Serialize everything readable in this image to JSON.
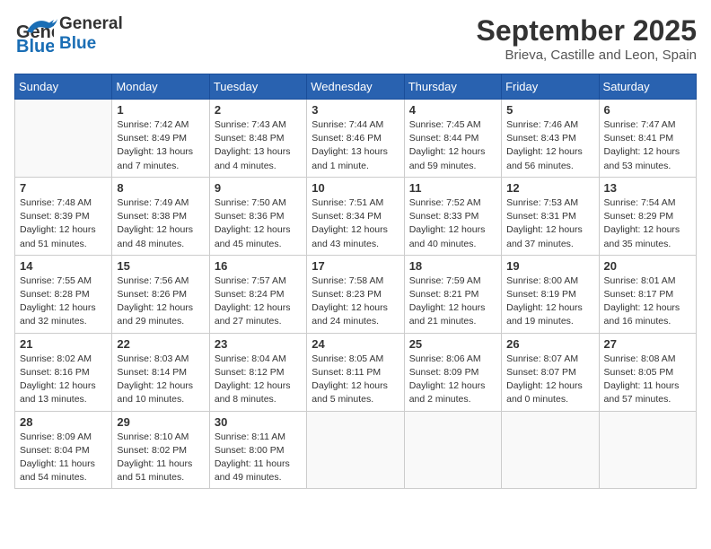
{
  "header": {
    "logo_general": "General",
    "logo_blue": "Blue",
    "month": "September 2025",
    "location": "Brieva, Castille and Leon, Spain"
  },
  "weekdays": [
    "Sunday",
    "Monday",
    "Tuesday",
    "Wednesday",
    "Thursday",
    "Friday",
    "Saturday"
  ],
  "weeks": [
    [
      {
        "day": "",
        "sunrise": "",
        "sunset": "",
        "daylight": "",
        "empty": true
      },
      {
        "day": "1",
        "sunrise": "Sunrise: 7:42 AM",
        "sunset": "Sunset: 8:49 PM",
        "daylight": "Daylight: 13 hours and 7 minutes."
      },
      {
        "day": "2",
        "sunrise": "Sunrise: 7:43 AM",
        "sunset": "Sunset: 8:48 PM",
        "daylight": "Daylight: 13 hours and 4 minutes."
      },
      {
        "day": "3",
        "sunrise": "Sunrise: 7:44 AM",
        "sunset": "Sunset: 8:46 PM",
        "daylight": "Daylight: 13 hours and 1 minute."
      },
      {
        "day": "4",
        "sunrise": "Sunrise: 7:45 AM",
        "sunset": "Sunset: 8:44 PM",
        "daylight": "Daylight: 12 hours and 59 minutes."
      },
      {
        "day": "5",
        "sunrise": "Sunrise: 7:46 AM",
        "sunset": "Sunset: 8:43 PM",
        "daylight": "Daylight: 12 hours and 56 minutes."
      },
      {
        "day": "6",
        "sunrise": "Sunrise: 7:47 AM",
        "sunset": "Sunset: 8:41 PM",
        "daylight": "Daylight: 12 hours and 53 minutes."
      }
    ],
    [
      {
        "day": "7",
        "sunrise": "Sunrise: 7:48 AM",
        "sunset": "Sunset: 8:39 PM",
        "daylight": "Daylight: 12 hours and 51 minutes."
      },
      {
        "day": "8",
        "sunrise": "Sunrise: 7:49 AM",
        "sunset": "Sunset: 8:38 PM",
        "daylight": "Daylight: 12 hours and 48 minutes."
      },
      {
        "day": "9",
        "sunrise": "Sunrise: 7:50 AM",
        "sunset": "Sunset: 8:36 PM",
        "daylight": "Daylight: 12 hours and 45 minutes."
      },
      {
        "day": "10",
        "sunrise": "Sunrise: 7:51 AM",
        "sunset": "Sunset: 8:34 PM",
        "daylight": "Daylight: 12 hours and 43 minutes."
      },
      {
        "day": "11",
        "sunrise": "Sunrise: 7:52 AM",
        "sunset": "Sunset: 8:33 PM",
        "daylight": "Daylight: 12 hours and 40 minutes."
      },
      {
        "day": "12",
        "sunrise": "Sunrise: 7:53 AM",
        "sunset": "Sunset: 8:31 PM",
        "daylight": "Daylight: 12 hours and 37 minutes."
      },
      {
        "day": "13",
        "sunrise": "Sunrise: 7:54 AM",
        "sunset": "Sunset: 8:29 PM",
        "daylight": "Daylight: 12 hours and 35 minutes."
      }
    ],
    [
      {
        "day": "14",
        "sunrise": "Sunrise: 7:55 AM",
        "sunset": "Sunset: 8:28 PM",
        "daylight": "Daylight: 12 hours and 32 minutes."
      },
      {
        "day": "15",
        "sunrise": "Sunrise: 7:56 AM",
        "sunset": "Sunset: 8:26 PM",
        "daylight": "Daylight: 12 hours and 29 minutes."
      },
      {
        "day": "16",
        "sunrise": "Sunrise: 7:57 AM",
        "sunset": "Sunset: 8:24 PM",
        "daylight": "Daylight: 12 hours and 27 minutes."
      },
      {
        "day": "17",
        "sunrise": "Sunrise: 7:58 AM",
        "sunset": "Sunset: 8:23 PM",
        "daylight": "Daylight: 12 hours and 24 minutes."
      },
      {
        "day": "18",
        "sunrise": "Sunrise: 7:59 AM",
        "sunset": "Sunset: 8:21 PM",
        "daylight": "Daylight: 12 hours and 21 minutes."
      },
      {
        "day": "19",
        "sunrise": "Sunrise: 8:00 AM",
        "sunset": "Sunset: 8:19 PM",
        "daylight": "Daylight: 12 hours and 19 minutes."
      },
      {
        "day": "20",
        "sunrise": "Sunrise: 8:01 AM",
        "sunset": "Sunset: 8:17 PM",
        "daylight": "Daylight: 12 hours and 16 minutes."
      }
    ],
    [
      {
        "day": "21",
        "sunrise": "Sunrise: 8:02 AM",
        "sunset": "Sunset: 8:16 PM",
        "daylight": "Daylight: 12 hours and 13 minutes."
      },
      {
        "day": "22",
        "sunrise": "Sunrise: 8:03 AM",
        "sunset": "Sunset: 8:14 PM",
        "daylight": "Daylight: 12 hours and 10 minutes."
      },
      {
        "day": "23",
        "sunrise": "Sunrise: 8:04 AM",
        "sunset": "Sunset: 8:12 PM",
        "daylight": "Daylight: 12 hours and 8 minutes."
      },
      {
        "day": "24",
        "sunrise": "Sunrise: 8:05 AM",
        "sunset": "Sunset: 8:11 PM",
        "daylight": "Daylight: 12 hours and 5 minutes."
      },
      {
        "day": "25",
        "sunrise": "Sunrise: 8:06 AM",
        "sunset": "Sunset: 8:09 PM",
        "daylight": "Daylight: 12 hours and 2 minutes."
      },
      {
        "day": "26",
        "sunrise": "Sunrise: 8:07 AM",
        "sunset": "Sunset: 8:07 PM",
        "daylight": "Daylight: 12 hours and 0 minutes."
      },
      {
        "day": "27",
        "sunrise": "Sunrise: 8:08 AM",
        "sunset": "Sunset: 8:05 PM",
        "daylight": "Daylight: 11 hours and 57 minutes."
      }
    ],
    [
      {
        "day": "28",
        "sunrise": "Sunrise: 8:09 AM",
        "sunset": "Sunset: 8:04 PM",
        "daylight": "Daylight: 11 hours and 54 minutes."
      },
      {
        "day": "29",
        "sunrise": "Sunrise: 8:10 AM",
        "sunset": "Sunset: 8:02 PM",
        "daylight": "Daylight: 11 hours and 51 minutes."
      },
      {
        "day": "30",
        "sunrise": "Sunrise: 8:11 AM",
        "sunset": "Sunset: 8:00 PM",
        "daylight": "Daylight: 11 hours and 49 minutes."
      },
      {
        "day": "",
        "sunrise": "",
        "sunset": "",
        "daylight": "",
        "empty": true
      },
      {
        "day": "",
        "sunrise": "",
        "sunset": "",
        "daylight": "",
        "empty": true
      },
      {
        "day": "",
        "sunrise": "",
        "sunset": "",
        "daylight": "",
        "empty": true
      },
      {
        "day": "",
        "sunrise": "",
        "sunset": "",
        "daylight": "",
        "empty": true
      }
    ]
  ]
}
